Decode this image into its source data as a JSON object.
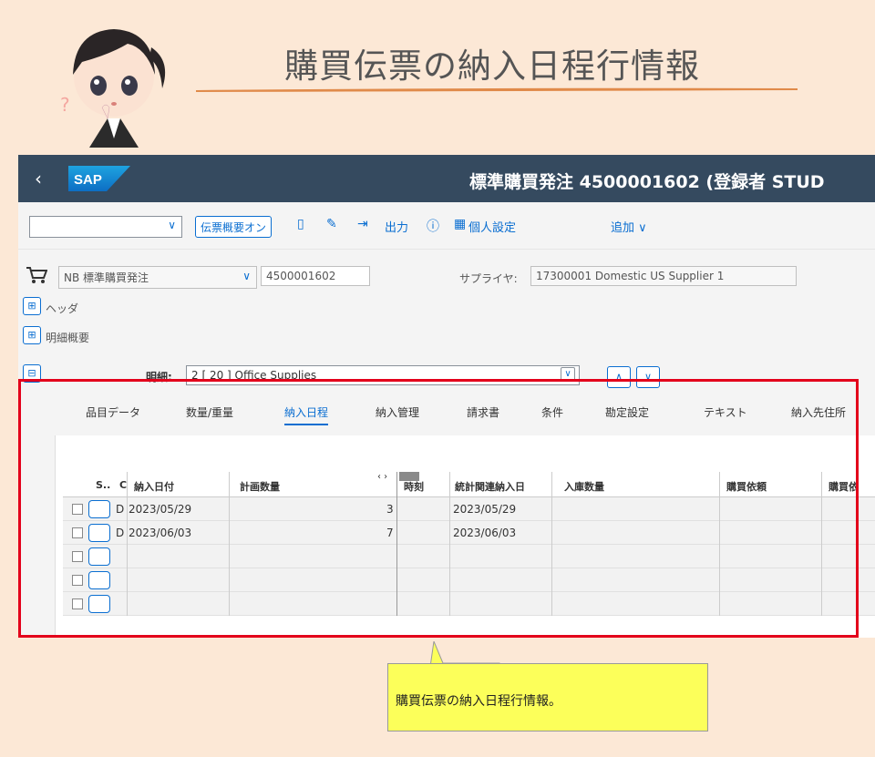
{
  "slide": {
    "title": "購買伝票の納入日程行情報",
    "callout": "購買伝票の納入日程行情報。"
  },
  "shell": {
    "back_icon": "chevron-left-icon",
    "logo_text": "SAP",
    "title": "標準購買発注 4500001602 (登録者 STUD"
  },
  "toolbar": {
    "overview_btn": "伝票概要オン",
    "output": "出力",
    "personal": "個人設定",
    "more": "追加 ∨"
  },
  "header": {
    "doc_type": "NB 標準購買発注",
    "po_number": "4500001602",
    "supplier_label": "サプライヤ:",
    "supplier_value": "17300001 Domestic US Supplier 1",
    "header_label": "ヘッダ",
    "item_overview_label": "明細概要"
  },
  "item": {
    "label": "明細:",
    "value": "2 [ 20 ] Office Supplies"
  },
  "tabs": [
    "品目データ",
    "数量/重量",
    "納入日程",
    "納入管理",
    "請求書",
    "条件",
    "勘定設定",
    "テキスト",
    "納入先住所"
  ],
  "active_tab": 2,
  "grid": {
    "headers": {
      "s": "S..",
      "c": "C",
      "delivery_date": "納入日付",
      "planned_qty": "計画数量",
      "time": "時刻",
      "stat_date": "統計関連納入日",
      "gr_qty": "入庫数量",
      "pr": "購買依頼",
      "pr2": "購買依"
    },
    "rows": [
      {
        "c": "D",
        "delivery_date": "2023/05/29",
        "planned_qty": "3",
        "stat_date": "2023/05/29"
      },
      {
        "c": "D",
        "delivery_date": "2023/06/03",
        "planned_qty": "7",
        "stat_date": "2023/06/03"
      },
      {
        "c": "",
        "delivery_date": "",
        "planned_qty": "",
        "stat_date": ""
      },
      {
        "c": "",
        "delivery_date": "",
        "planned_qty": "",
        "stat_date": ""
      },
      {
        "c": "",
        "delivery_date": "",
        "planned_qty": "",
        "stat_date": ""
      }
    ],
    "scroll_arrows": "‹ ›"
  },
  "colors": {
    "shell": "#354a5f",
    "accent": "#0a6ed1",
    "frame": "#e3001b",
    "callout": "#fcff5a",
    "background": "#fce8d6"
  }
}
